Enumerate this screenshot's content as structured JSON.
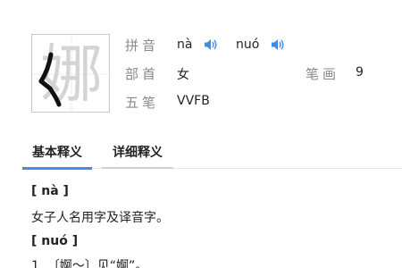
{
  "character": {
    "glyph": "娜"
  },
  "info": {
    "pinyin_label": "拼音",
    "pinyin_1": "nà",
    "pinyin_2": "nuó",
    "radical_label": "部首",
    "radical_value": "女",
    "strokes_label": "笔画",
    "strokes_value": "9",
    "wubi_label": "五笔",
    "wubi_value": "VVFB"
  },
  "icons": {
    "sound": "speaker-icon",
    "sound_color": "#3e8ee8"
  },
  "tabs": [
    {
      "label": "基本释义"
    },
    {
      "label": "详细释义"
    }
  ],
  "colors": {
    "active_tab": "#3e8ee8",
    "label": "#8a8a8a"
  },
  "definitions": {
    "heading_1": "[ nà ]",
    "text_1": "女子人名用字及译音字。",
    "heading_2": "[ nuó ]",
    "text_2": "1. 〔婀～〕见“婀”。"
  }
}
